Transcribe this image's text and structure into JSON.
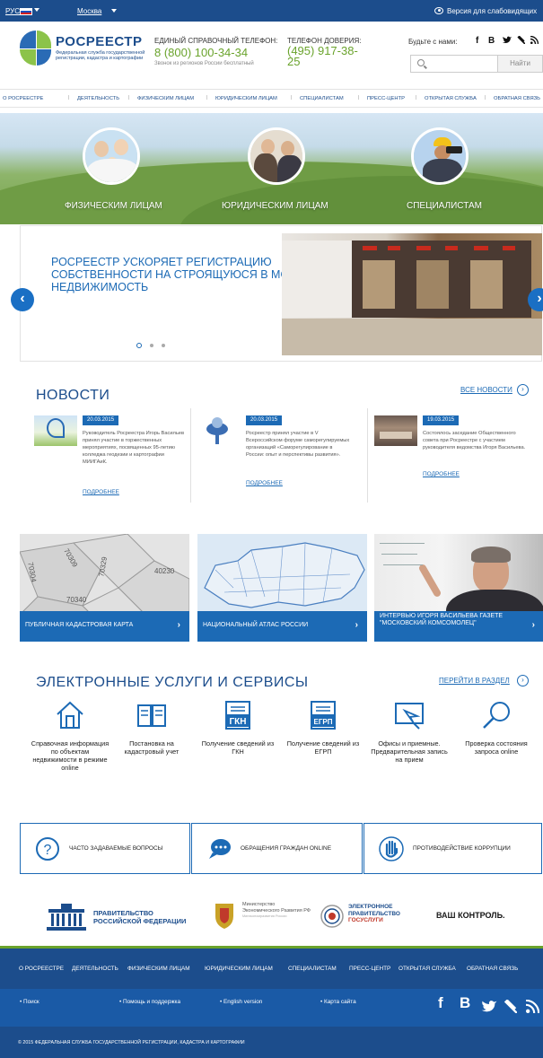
{
  "topbar": {
    "lang": "РУС",
    "city": "Москва",
    "accessibility": "Версия для слабовидящих"
  },
  "header": {
    "brand": "РОСРЕЕСТР",
    "brand_sub": "Федеральная служба государственной регистрации, кадастра и картографии",
    "hotline_label": "ЕДИНЫЙ СПРАВОЧНЫЙ ТЕЛЕФОН:",
    "hotline_number": "8 (800) 100-34-34",
    "hotline_note": "Звонок из регионов России бесплатный",
    "trust_label": "ТЕЛЕФОН ДОВЕРИЯ:",
    "trust_number": "(495) 917-38-25",
    "social_label": "Будьте с нами:",
    "search_placeholder": "",
    "search_button": "Найти"
  },
  "nav": [
    "О РОСРЕЕСТРЕ",
    "ДЕЯТЕЛЬНОСТЬ",
    "ФИЗИЧЕСКИМ ЛИЦАМ",
    "ЮРИДИЧЕСКИМ ЛИЦАМ",
    "СПЕЦИАЛИСТАМ",
    "ПРЕСС-ЦЕНТР",
    "ОТКРЫТАЯ СЛУЖБА",
    "ОБРАТНАЯ СВЯЗЬ"
  ],
  "hero": {
    "items": [
      "ФИЗИЧЕСКИМ ЛИЦАМ",
      "ЮРИДИЧЕСКИМ ЛИЦАМ",
      "СПЕЦИАЛИСТАМ"
    ]
  },
  "slider": {
    "title": "РОСРЕЕСТР УСКОРЯЕТ РЕГИСТРАЦИЮ СОБСТВЕННОСТИ НА СТРОЯЩУЮСЯ В МОСКВЕ НЕДВИЖИМОСТЬ",
    "prev": "‹",
    "next": "›"
  },
  "news": {
    "title": "НОВОСТИ",
    "all_link": "ВСЕ НОВОСТИ",
    "more": "ПОДРОБНЕЕ",
    "items": [
      {
        "date": "20.03.2015",
        "text": "Руководитель Росреестра Игорь Васильев принял участие в торжественных мероприятиях, посвященных 95-летию колледжа геодезии и картографии МИИГАиК."
      },
      {
        "date": "20.03.2015",
        "text": "Росреестр принял участие в V Всероссийском форуме саморегулируемых организаций «Саморегулирование в России: опыт и перспективы развития»."
      },
      {
        "date": "19.03.2015",
        "text": "Состоялось заседание Общественного совета при Росреестре с участием руководителя ведомства Игоря Васильева."
      }
    ]
  },
  "cards": [
    {
      "label": "ПУБЛИЧНАЯ КАДАСТРОВАЯ КАРТА",
      "map_labels": [
        "70304",
        "70309",
        "70329",
        "40230",
        "70340"
      ]
    },
    {
      "label": "НАЦИОНАЛЬНЫЙ АТЛАС РОССИИ"
    },
    {
      "label": "ИНТЕРВЬЮ ИГОРЯ ВАСИЛЬЕВА ГАЗЕТЕ \"МОСКОВСКИЙ КОМСОМОЛЕЦ\""
    }
  ],
  "services": {
    "title": "ЭЛЕКТРОННЫЕ УСЛУГИ И СЕРВИСЫ",
    "link": "ПЕРЕЙТИ В РАЗДЕЛ",
    "items": [
      {
        "label": "Справочная информация по объектам недвижимости в режиме online",
        "icon": "house-icon"
      },
      {
        "label": "Постановка на кадастровый учет",
        "icon": "book-icon"
      },
      {
        "label": "Получение сведений из ГКН",
        "icon": "document-icon",
        "badge": "ГКН"
      },
      {
        "label": "Получение сведений из ЕГРП",
        "icon": "document-icon",
        "badge": "ЕГРП"
      },
      {
        "label": "Офисы и приемные. Предварительная запись на прием",
        "icon": "map-pointer-icon"
      },
      {
        "label": "Проверка состояния запроса online",
        "icon": "magnifier-icon"
      }
    ]
  },
  "help": [
    {
      "label": "ЧАСТО ЗАДАВАЕМЫЕ ВОПРОСЫ",
      "glyph": "?"
    },
    {
      "label": "ОБРАЩЕНИЯ ГРАЖДАН ONLINE",
      "glyph": ""
    },
    {
      "label": "ПРОТИВОДЕЙСТВИЕ КОРРУПЦИИ",
      "glyph": ""
    }
  ],
  "partners": {
    "gov_line1": "ПРАВИТЕЛЬСТВО",
    "gov_line2": "РОССИЙСКОЙ ФЕДЕРАЦИИ",
    "mer": "Министерство Экономического Развития РФ",
    "mer_small": "Минэкономразвития России",
    "gosuslugi_1": "ЭЛЕКТРОННОЕ",
    "gosuslugi_2": "ПРАВИТЕЛЬСТВО",
    "gosuslugi_3": "ГОСУСЛУГИ",
    "control_1": "ВАШ",
    "control_2": "КОНТРОЛЬ."
  },
  "footer": {
    "nav": [
      "О РОСРЕЕСТРЕ",
      "ДЕЯТЕЛЬНОСТЬ",
      "ФИЗИЧЕСКИМ ЛИЦАМ",
      "ЮРИДИЧЕСКИМ ЛИЦАМ",
      "СПЕЦИАЛИСТАМ",
      "ПРЕСС-ЦЕНТР",
      "ОТКРЫТАЯ СЛУЖБА",
      "ОБРАТНАЯ СВЯЗЬ"
    ],
    "links": [
      "Поиск",
      "Помощь и поддержка",
      "English version",
      "Карта сайта"
    ],
    "copyright": "© 2015 ФЕДЕРАЛЬНАЯ СЛУЖБА ГОСУДАРСТВЕННОЙ РЕГИСТРАЦИИ, КАДАСТРА И КАРТОГРАФИИ"
  },
  "colors": {
    "brand_blue": "#1c4d8c",
    "link_blue": "#1c6ab5",
    "accent_green": "#6aa32c"
  }
}
